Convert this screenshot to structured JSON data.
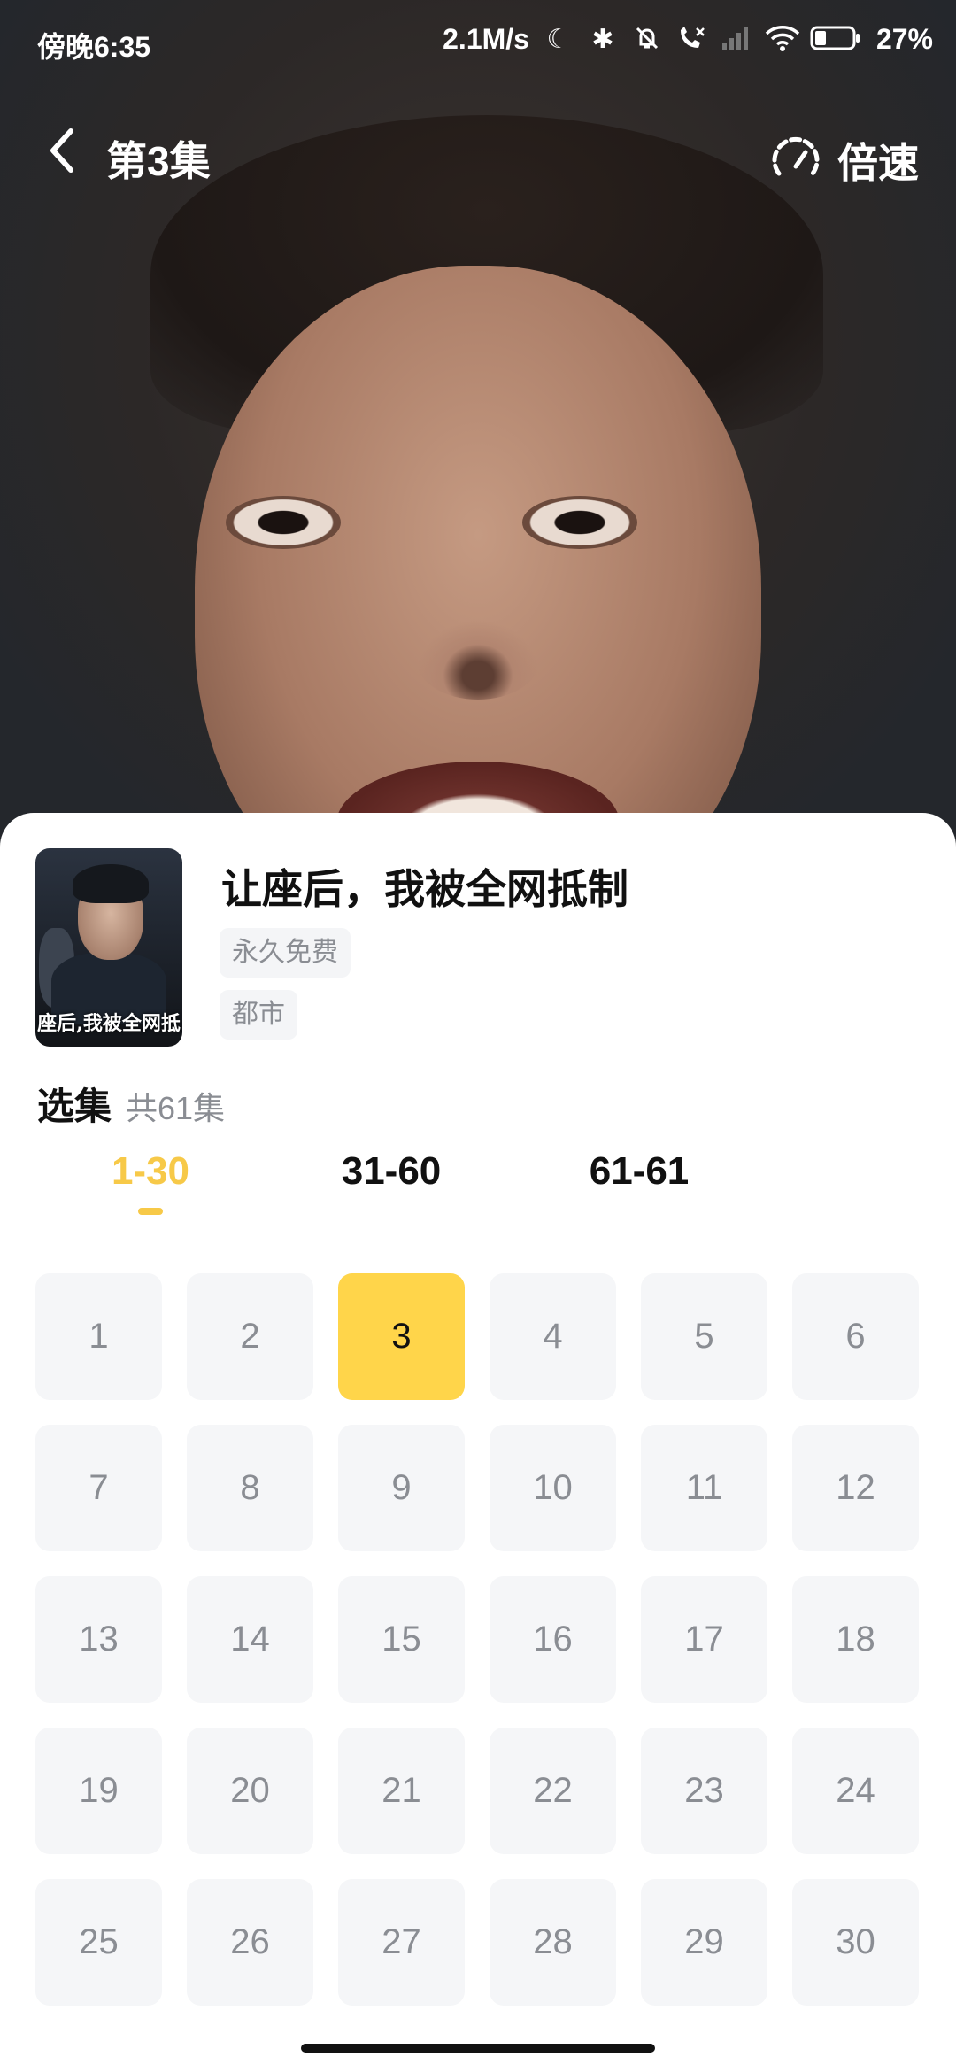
{
  "status_bar": {
    "time": "傍晚6:35",
    "net_speed": "2.1M/s",
    "battery": "27%",
    "icons": [
      "moon-icon",
      "bluetooth-icon",
      "mute-bell-icon",
      "call-icon",
      "signal-icon",
      "wifi-icon",
      "battery-icon"
    ]
  },
  "top_bar": {
    "episode_title": "第3集",
    "speed_label": "倍速"
  },
  "drama": {
    "title": "让座后，我被全网抵制",
    "poster_text": "座后,我被全网抵",
    "tags": [
      "永久免费",
      "都市"
    ]
  },
  "episodes": {
    "heading": "选集",
    "count_text": "共61集",
    "ranges": [
      "1-30",
      "31-60",
      "61-61"
    ],
    "active_range": "1-30",
    "current": "3",
    "items": [
      "1",
      "2",
      "3",
      "4",
      "5",
      "6",
      "7",
      "8",
      "9",
      "10",
      "11",
      "12",
      "13",
      "14",
      "15",
      "16",
      "17",
      "18",
      "19",
      "20",
      "21",
      "22",
      "23",
      "24",
      "25",
      "26",
      "27",
      "28",
      "29",
      "30"
    ]
  },
  "colors": {
    "accent": "#ffd54a",
    "accent_text": "#f7c948",
    "cell_bg": "#f5f6f8",
    "muted_text": "#8a8d93"
  }
}
